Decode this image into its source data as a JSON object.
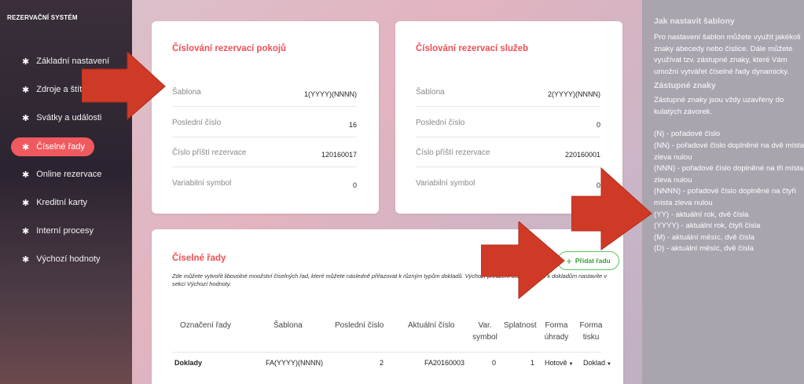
{
  "sidebar": {
    "brand": "REZERVAČNÍ SYSTÉM",
    "items": [
      {
        "label": "Základní nastavení",
        "icon": "gear-icon",
        "active": false
      },
      {
        "label": "Zdroje a štítky",
        "icon": "gear-icon",
        "active": false
      },
      {
        "label": "Svátky a události",
        "icon": "gear-icon",
        "active": false
      },
      {
        "label": "Číselné řady",
        "icon": "gear-icon",
        "active": true
      },
      {
        "label": "Online rezervace",
        "icon": "gear-icon",
        "active": false
      },
      {
        "label": "Kreditní karty",
        "icon": "gear-icon",
        "active": false
      },
      {
        "label": "Interní procesy",
        "icon": "gear-icon",
        "active": false
      },
      {
        "label": "Výchozí hodnoty",
        "icon": "gear-icon",
        "active": false
      }
    ]
  },
  "rooms_card": {
    "title": "Číslování rezervací pokojů",
    "rows": [
      {
        "label": "Šablona",
        "value": "1(YYYY)(NNNN)"
      },
      {
        "label": "Poslední číslo",
        "value": "16"
      },
      {
        "label": "Číslo příští rezervace",
        "value": "120160017"
      },
      {
        "label": "Variabilní symbol",
        "value": "0"
      }
    ]
  },
  "services_card": {
    "title": "Číslování rezervací služeb",
    "rows": [
      {
        "label": "Šablona",
        "value": "2(YYYY)(NNNN)"
      },
      {
        "label": "Poslední číslo",
        "value": "0"
      },
      {
        "label": "Číslo příští rezervace",
        "value": "220160001"
      },
      {
        "label": "Variabilní symbol",
        "value": "0"
      }
    ]
  },
  "series_card": {
    "title": "Číselné řady",
    "add_button": "Přidat řadu",
    "description": "Zde můžete vytvořit libovolné množství číselných řad, které můžete následně přiřazovat k různým typům dokladů. Výchozí přiřazení číselných řad k dokladům nastavíte v sekci Výchozí hodnoty.",
    "columns": [
      "Označení řady",
      "Šablona",
      "Poslední číslo",
      "Aktuální číslo",
      "Var. symbol",
      "Splatnost",
      "Forma úhrady",
      "Forma tisku"
    ],
    "rows": [
      {
        "name": "Doklady",
        "template": "FA(YYYY)(NNNN)",
        "last": "2",
        "current": "FA20160003",
        "var_symbol": "0",
        "due": "1",
        "payment": "Hotově",
        "print": "Doklad"
      }
    ]
  },
  "help": {
    "title": "Jak nastavit šablony",
    "intro": "Pro nastavení šablon můžete využít jakékoli znaky abecedy nebo číslice. Dále můžete využívat tzv. zástupné znaky, které Vám umožní vytvářet číselné řady dynamicky.",
    "subtitle": "Zástupné znaky",
    "sub_intro": "Zástupné znaky jsou vždy uzavřeny do kulatých závorek.",
    "codes": [
      "(N) - pořadové číslo",
      "(NN) - pořadové číslo doplněné na dvě místa zleva nulou",
      "(NNN) - pořadové číslo doplněné na tři místa zleva nulou",
      "(NNNN) - pořadové číslo doplněné na čtyři místa zleva nulou",
      "(YY) - aktuální rok, dvě čísla",
      "(YYYY) - aktuální rok, čtyři čísla",
      "(M) - aktuální měsíc, dvě čísla",
      "(D) - aktuální měsíc, dvě čísla"
    ]
  },
  "colors": {
    "accent": "#f05a5f",
    "arrow": "#cf3a27",
    "add_button": "#5cc45c"
  }
}
